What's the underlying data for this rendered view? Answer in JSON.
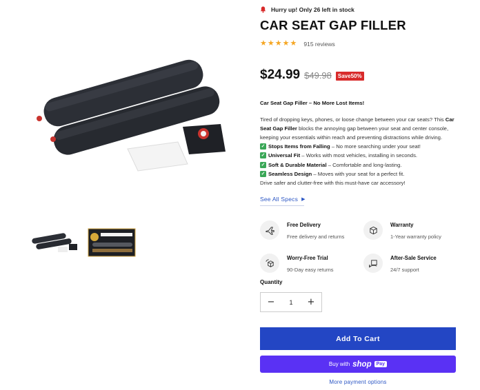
{
  "product": {
    "stock_notice": "Hurry up! Only 26 left in stock",
    "title": "CAR SEAT GAP FILLER",
    "rating_stars": 5,
    "reviews_label": "915 reviews",
    "price": "$24.99",
    "old_price": "$49.98",
    "save_badge": "Save50%"
  },
  "description": {
    "heading": "Car Seat Gap Filler – No More Lost Items!",
    "intro_1": "Tired of dropping keys, phones, or loose change between your car seats? This ",
    "intro_bold": "Car Seat Gap Filler",
    "intro_2": " blocks the annoying gap between your seat and center console, keeping your essentials within reach and preventing distractions while driving.",
    "features": [
      {
        "title": "Stops Items from Falling",
        "text": " – No more searching under your seat!"
      },
      {
        "title": "Universal Fit",
        "text": " – Works with most vehicles, installing in seconds."
      },
      {
        "title": "Soft & Durable Material",
        "text": " – Comfortable and long-lasting."
      },
      {
        "title": "Seamless Design",
        "text": " – Moves with your seat for a perfect fit."
      }
    ],
    "outro": "Drive safer and clutter-free with this must-have car accessory!",
    "check_glyph": "✓"
  },
  "specs_link": "See All Specs",
  "perks": [
    {
      "title": "Free Delivery",
      "subtitle": "Free delivery and returns",
      "icon": "plane-icon"
    },
    {
      "title": "Warranty",
      "subtitle": "1-Year warranty policy",
      "icon": "box-icon"
    },
    {
      "title": "Worry-Free Trial",
      "subtitle": "90-Day easy returns",
      "icon": "return-box-icon"
    },
    {
      "title": "After-Sale Service",
      "subtitle": "24/7 support",
      "icon": "service-icon"
    }
  ],
  "quantity": {
    "label": "Quantity",
    "value": "1",
    "minus": "−",
    "plus": "+"
  },
  "buttons": {
    "add_to_cart": "Add To Cart",
    "buy_with": "Buy with",
    "shop": "shop",
    "pay": "Pay",
    "more_payment": "More payment options"
  },
  "gallery": {
    "thumb_box_text": "CAR SEAT GAP FILLER"
  },
  "colors": {
    "accent_blue": "#2346c4",
    "shop_pay_purple": "#5a31f4",
    "sale_red": "#d82a2a",
    "star": "#f5a623",
    "check_green": "#3aa757"
  }
}
